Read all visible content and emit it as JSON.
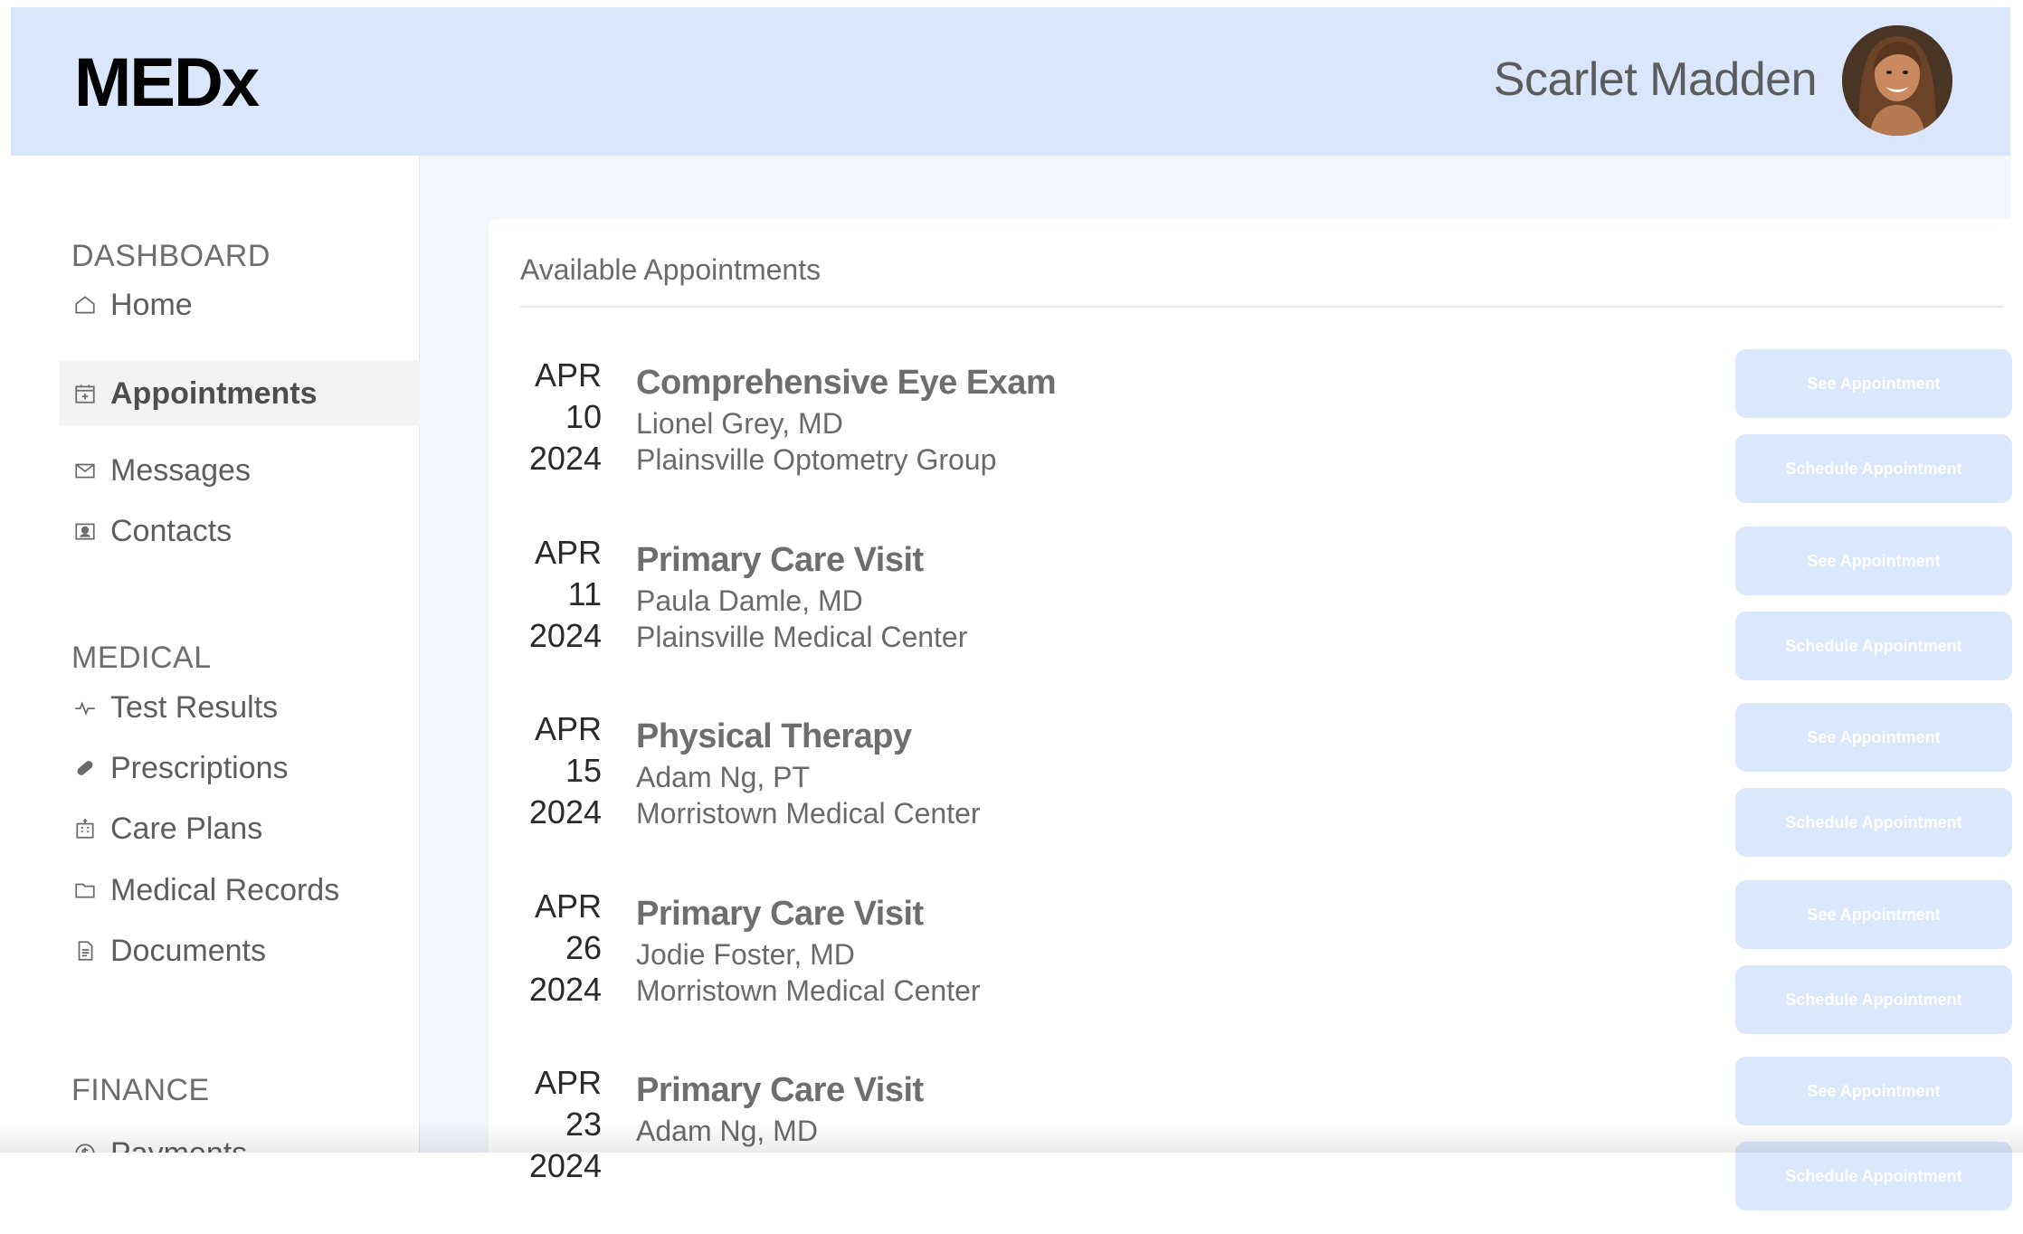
{
  "app": {
    "logo": "MEDx"
  },
  "user": {
    "name": "Scarlet Madden"
  },
  "sidebar": {
    "sections": [
      {
        "title": "DASHBOARD",
        "items": [
          {
            "label": "Home",
            "icon": "home-icon"
          },
          {
            "label": "Appointments",
            "icon": "calendar-icon",
            "active": true
          },
          {
            "label": "Messages",
            "icon": "envelope-icon"
          },
          {
            "label": "Contacts",
            "icon": "contact-card-icon"
          }
        ]
      },
      {
        "title": "MEDICAL",
        "items": [
          {
            "label": "Test Results",
            "icon": "pulse-icon"
          },
          {
            "label": "Prescriptions",
            "icon": "pill-icon"
          },
          {
            "label": "Care Plans",
            "icon": "hospital-icon"
          },
          {
            "label": "Medical Records",
            "icon": "folder-icon"
          },
          {
            "label": "Documents",
            "icon": "document-icon"
          }
        ]
      },
      {
        "title": "FINANCE",
        "items": [
          {
            "label": "Payments",
            "icon": "dollar-icon"
          }
        ]
      }
    ]
  },
  "main": {
    "title": "Available Appointments",
    "see_label": "See Appointment",
    "schedule_label": "Schedule Appointment",
    "appointments": [
      {
        "month": "APR",
        "day": "10",
        "year": "2024",
        "type": "Comprehensive Eye Exam",
        "provider": "Lionel Grey, MD",
        "location": "Plainsville Optometry Group"
      },
      {
        "month": "APR",
        "day": "11",
        "year": "2024",
        "type": "Primary Care Visit",
        "provider": "Paula Damle, MD",
        "location": "Plainsville Medical Center"
      },
      {
        "month": "APR",
        "day": "15",
        "year": "2024",
        "type": "Physical Therapy",
        "provider": "Adam Ng, PT",
        "location": "Morristown Medical Center"
      },
      {
        "month": "APR",
        "day": "26",
        "year": "2024",
        "type": "Primary Care Visit",
        "provider": "Jodie Foster, MD",
        "location": "Morristown Medical Center"
      },
      {
        "month": "APR",
        "day": "23",
        "year": "2024",
        "type": "Primary Care Visit",
        "provider": "Adam Ng, MD",
        "location": ""
      }
    ]
  },
  "colors": {
    "header_bg": "#dae6fc",
    "button_bg": "#dbe7fd",
    "main_bg": "#f3f6fd"
  }
}
